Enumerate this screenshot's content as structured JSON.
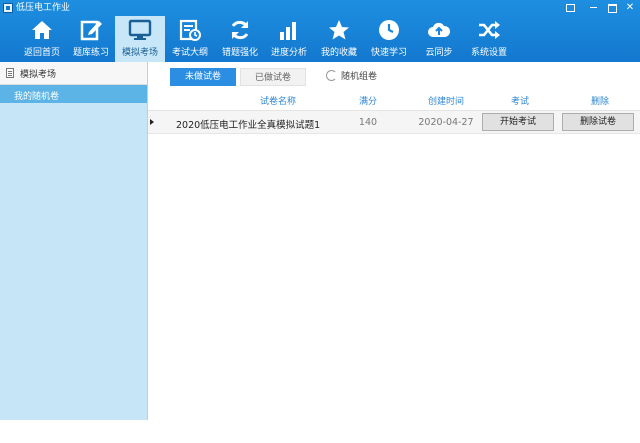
{
  "window": {
    "title": "低压电工作业"
  },
  "toolbar": {
    "items": [
      {
        "label": "返回首页",
        "icon": "home-icon"
      },
      {
        "label": "题库练习",
        "icon": "edit-icon"
      },
      {
        "label": "模拟考场",
        "icon": "monitor-icon"
      },
      {
        "label": "考试大纲",
        "icon": "calendar-icon"
      },
      {
        "label": "错题强化",
        "icon": "refresh-icon"
      },
      {
        "label": "进度分析",
        "icon": "bar-chart-icon"
      },
      {
        "label": "我的收藏",
        "icon": "star-icon"
      },
      {
        "label": "快速学习",
        "icon": "clock-icon"
      },
      {
        "label": "云同步",
        "icon": "cloud-icon"
      },
      {
        "label": "系统设置",
        "icon": "shuffle-icon"
      }
    ],
    "active_index": 2
  },
  "sidebar": {
    "header": "模拟考场",
    "items": [
      {
        "label": "我的随机卷",
        "selected": true
      }
    ]
  },
  "tabs": {
    "unused": "未做试卷",
    "used": "已做试卷",
    "random": "随机组卷"
  },
  "table": {
    "columns": {
      "name": "试卷名称",
      "score": "满分",
      "date": "创建时间",
      "exam": "考试",
      "delete": "删除"
    },
    "rows": [
      {
        "name": "2020低压电工作业全真模拟试题1",
        "score": "140",
        "date": "2020-04-27",
        "start_label": "开始考试",
        "delete_label": "删除试卷"
      }
    ]
  },
  "colors": {
    "header_bg": "#1a85da",
    "active_tab": "#2c8ee2",
    "sidebar_bg": "#c6e5f6",
    "sidebar_selected": "#5cb4e6"
  }
}
